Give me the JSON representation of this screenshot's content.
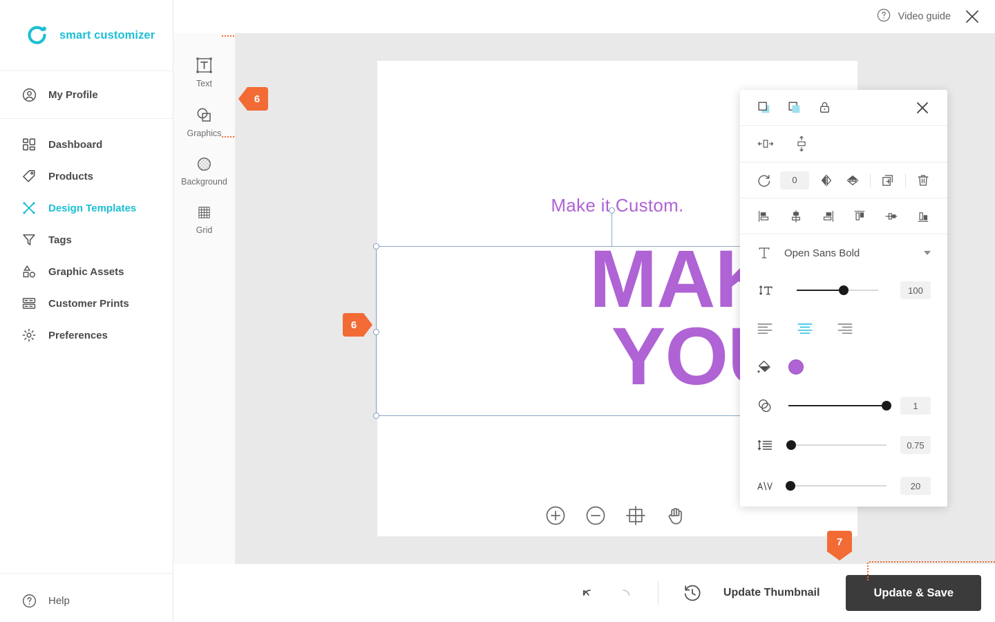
{
  "brand": {
    "name": "smart customizer",
    "logo_icon": "ring-dot-logo-icon",
    "accent": "#1bbfd4"
  },
  "sidebar": {
    "profile": {
      "label": "My Profile",
      "icon": "user-circle-icon"
    },
    "items": [
      {
        "label": "Dashboard",
        "icon": "dashboard-grid-icon",
        "active": false
      },
      {
        "label": "Products",
        "icon": "tag-icon",
        "active": false
      },
      {
        "label": "Design Templates",
        "icon": "scissors-cross-icon",
        "active": true
      },
      {
        "label": "Tags",
        "icon": "funnel-icon",
        "active": false
      },
      {
        "label": "Graphic Assets",
        "icon": "shapes-icon",
        "active": false
      },
      {
        "label": "Customer Prints",
        "icon": "prints-stack-icon",
        "active": false
      },
      {
        "label": "Preferences",
        "icon": "gear-icon",
        "active": false
      }
    ],
    "help": {
      "label": "Help",
      "icon": "question-circle-icon"
    }
  },
  "topbar": {
    "video_guide": "Video guide",
    "video_guide_icon": "question-circle-icon",
    "close_icon": "close-icon"
  },
  "toolrail": {
    "tools": [
      {
        "label": "Text",
        "icon": "text-box-icon"
      },
      {
        "label": "Graphics",
        "icon": "shapes-overlap-icon"
      },
      {
        "label": "Background",
        "icon": "checker-circle-icon"
      },
      {
        "label": "Grid",
        "icon": "grid-icon"
      }
    ]
  },
  "canvas": {
    "subtitle": "Make it Custom.",
    "headline": "MAKE IT\nYOURS",
    "text_color": "#af63d4",
    "zoom_controls": [
      {
        "icon": "zoom-in-icon"
      },
      {
        "icon": "zoom-out-icon"
      },
      {
        "icon": "fit-to-screen-icon"
      },
      {
        "icon": "pan-hand-icon"
      }
    ]
  },
  "markers": [
    {
      "id": "6a",
      "label": "6",
      "direction": "left"
    },
    {
      "id": "6b",
      "label": "6",
      "direction": "right"
    },
    {
      "id": "7",
      "label": "7",
      "direction": "down"
    }
  ],
  "properties_panel": {
    "close_icon": "close-icon",
    "layer_row": [
      {
        "icon": "bring-to-front-icon"
      },
      {
        "icon": "send-to-back-icon"
      },
      {
        "icon": "lock-icon"
      }
    ],
    "fit_row": [
      {
        "icon": "fit-width-icon"
      },
      {
        "icon": "fit-height-icon"
      }
    ],
    "transform_row": {
      "rotate_icon": "rotate-icon",
      "rotation_value": "0",
      "flip_horizontal_icon": "flip-horizontal-icon",
      "flip_vertical_icon": "flip-vertical-icon",
      "duplicate_icon": "duplicate-icon",
      "delete_icon": "trash-icon"
    },
    "align_row": [
      {
        "icon": "align-left-icon"
      },
      {
        "icon": "align-center-horizontal-icon"
      },
      {
        "icon": "align-right-icon"
      },
      {
        "icon": "align-top-icon"
      },
      {
        "icon": "align-middle-vertical-icon"
      },
      {
        "icon": "align-bottom-icon"
      }
    ],
    "font": {
      "icon": "font-family-icon",
      "name": "Open Sans Bold",
      "caret_icon": "chevron-down-icon"
    },
    "font_size": {
      "icon": "font-size-icon",
      "value": "100",
      "percent": 58
    },
    "text_align": [
      {
        "icon": "text-align-left-icon",
        "active": false
      },
      {
        "icon": "text-align-center-icon",
        "active": true
      },
      {
        "icon": "text-align-right-icon",
        "active": false
      }
    ],
    "fill": {
      "icon": "paint-bucket-icon",
      "color": "#af63d4"
    },
    "opacity": {
      "icon": "opacity-icon",
      "value": "1",
      "percent": 100
    },
    "line_height": {
      "icon": "line-height-icon",
      "value": "0.75",
      "percent": 3
    },
    "letter_spacing": {
      "icon": "letter-spacing-icon",
      "value": "20",
      "percent": 2
    }
  },
  "bottombar": {
    "undo_icon": "undo-icon",
    "redo_icon": "redo-icon",
    "history_icon": "history-clock-icon",
    "update_thumbnail_label": "Update Thumbnail",
    "update_save_label": "Update & Save"
  }
}
